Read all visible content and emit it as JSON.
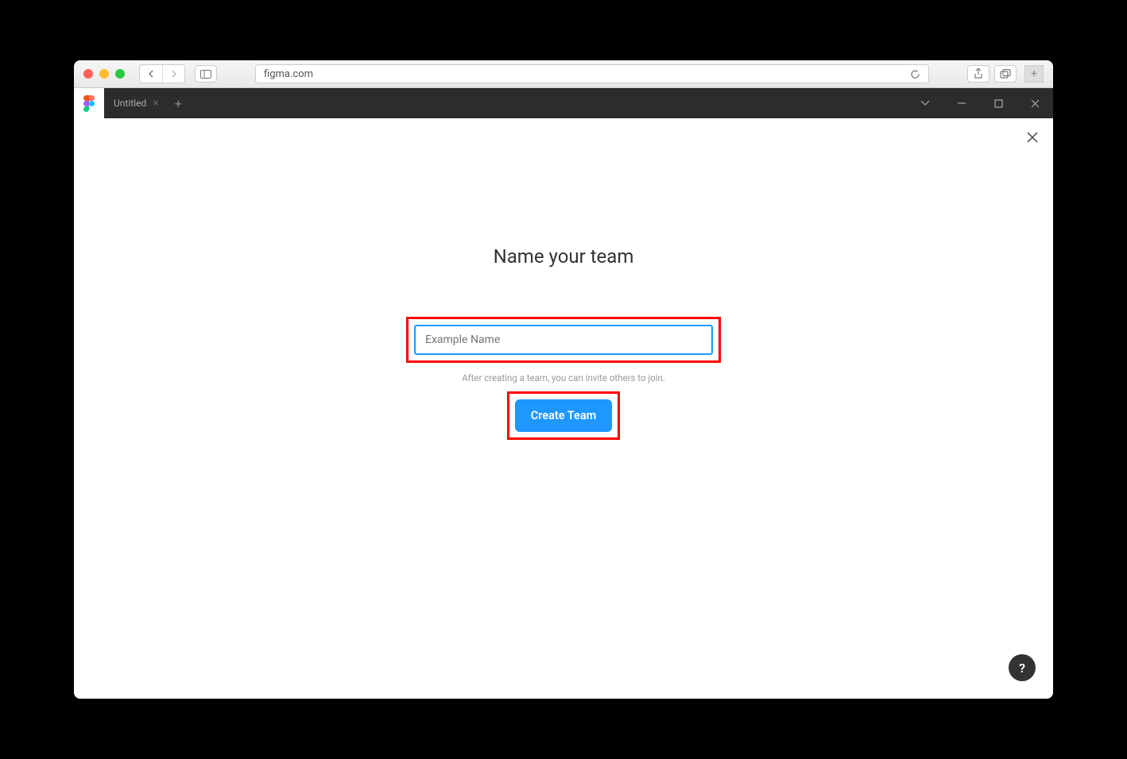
{
  "browser": {
    "url": "figma.com"
  },
  "app_tab": {
    "title": "Untitled"
  },
  "dialog": {
    "heading": "Name your team",
    "input_placeholder": "Example Name",
    "input_value": "",
    "helper_text": "After creating a team, you can invite others to join.",
    "create_button_label": "Create Team"
  },
  "help_bubble_label": "?"
}
